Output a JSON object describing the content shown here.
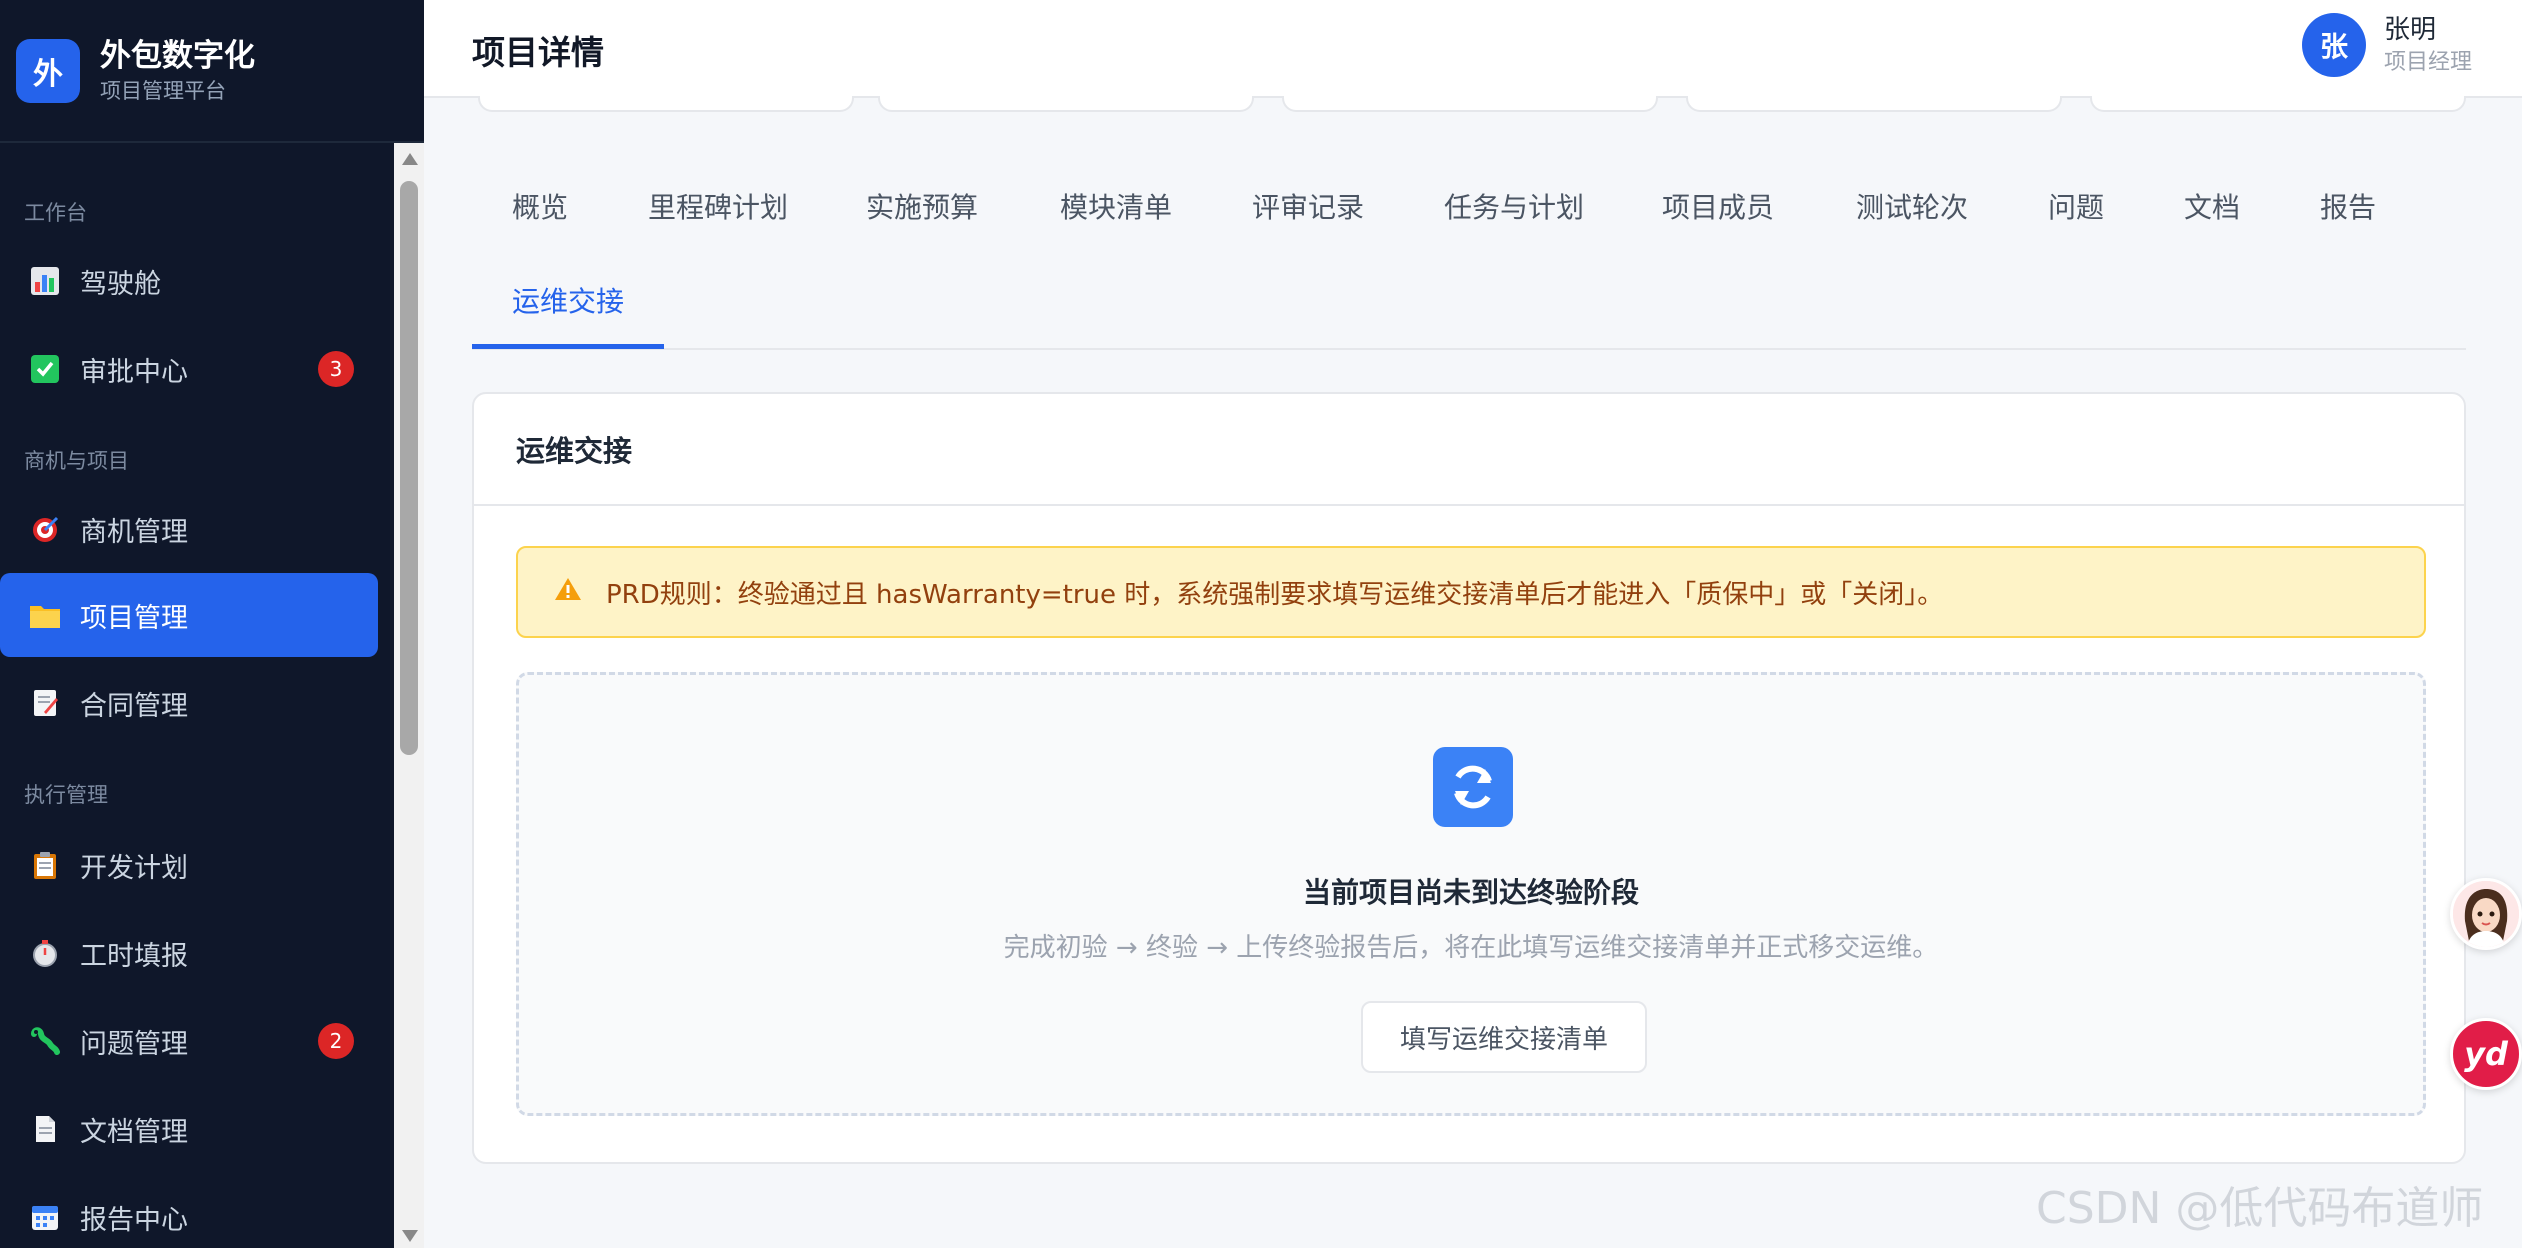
{
  "brand": {
    "logo": "外",
    "title": "外包数字化",
    "subtitle": "项目管理平台"
  },
  "sidebar": {
    "sections": [
      "工作台",
      "商机与项目",
      "执行管理"
    ],
    "items": [
      {
        "label": "驾驶舱",
        "icon": "bar-chart-icon",
        "badge": ""
      },
      {
        "label": "审批中心",
        "icon": "checkbox-icon",
        "badge": "3"
      },
      {
        "label": "商机管理",
        "icon": "target-icon",
        "badge": ""
      },
      {
        "label": "项目管理",
        "icon": "folder-icon",
        "badge": "",
        "active": true
      },
      {
        "label": "合同管理",
        "icon": "memo-icon",
        "badge": ""
      },
      {
        "label": "开发计划",
        "icon": "clipboard-icon",
        "badge": ""
      },
      {
        "label": "工时填报",
        "icon": "stopwatch-icon",
        "badge": ""
      },
      {
        "label": "问题管理",
        "icon": "bug-icon",
        "badge": "2"
      },
      {
        "label": "文档管理",
        "icon": "document-icon",
        "badge": ""
      },
      {
        "label": "报告中心",
        "icon": "calendar-icon",
        "badge": ""
      }
    ]
  },
  "header": {
    "title": "项目详情"
  },
  "user": {
    "avatar": "张",
    "name": "张明",
    "role": "项目经理"
  },
  "tabs": [
    {
      "label": "概览"
    },
    {
      "label": "里程碑计划"
    },
    {
      "label": "实施预算"
    },
    {
      "label": "模块清单"
    },
    {
      "label": "评审记录"
    },
    {
      "label": "任务与计划"
    },
    {
      "label": "项目成员"
    },
    {
      "label": "测试轮次"
    },
    {
      "label": "问题"
    },
    {
      "label": "文档"
    },
    {
      "label": "报告"
    },
    {
      "label": "运维交接",
      "active": true
    }
  ],
  "card": {
    "title": "运维交接",
    "alert": "PRD规则：终验通过且 hasWarranty=true 时，系统强制要求填写运维交接清单后才能进入「质保中」或「关闭」。",
    "empty_title": "当前项目尚未到达终验阶段",
    "empty_desc": "完成初验 → 终验 → 上传终验报告后，将在此填写运维交接清单并正式移交运维。",
    "button": "填写运维交接清单"
  },
  "floating": {
    "yd": "yd"
  },
  "watermark": "CSDN @低代码布道师",
  "colors": {
    "accent": "#2563eb",
    "sidebar_bg": "#0f172a",
    "badge": "#dc2626",
    "alert_bg": "#fef3c7"
  }
}
